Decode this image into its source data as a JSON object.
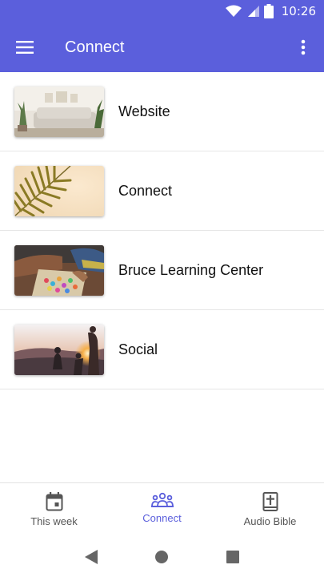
{
  "status_bar": {
    "time": "10:26",
    "icons": [
      "wifi-icon",
      "cell-signal-icon",
      "battery-icon"
    ]
  },
  "app_bar": {
    "title": "Connect",
    "left_icon": "hamburger-menu-icon",
    "right_icon": "more-vert-icon",
    "background": "#5b5fdc"
  },
  "list": {
    "items": [
      {
        "label": "Website",
        "thumbnail": "living-room-photo"
      },
      {
        "label": "Connect",
        "thumbnail": "palm-leaf-photo"
      },
      {
        "label": "Bruce Learning Center",
        "thumbnail": "kids-playing-photo"
      },
      {
        "label": "Social",
        "thumbnail": "sunset-friends-photo"
      }
    ]
  },
  "bottom_nav": {
    "active_color": "#5b5fdc",
    "tabs": [
      {
        "label": "This week",
        "icon": "calendar-icon",
        "active": false
      },
      {
        "label": "Connect",
        "icon": "group-icon",
        "active": true
      },
      {
        "label": "Audio Bible",
        "icon": "bible-icon",
        "active": false
      }
    ]
  },
  "system_nav": {
    "buttons": [
      "back-icon",
      "home-icon",
      "recents-icon"
    ]
  }
}
